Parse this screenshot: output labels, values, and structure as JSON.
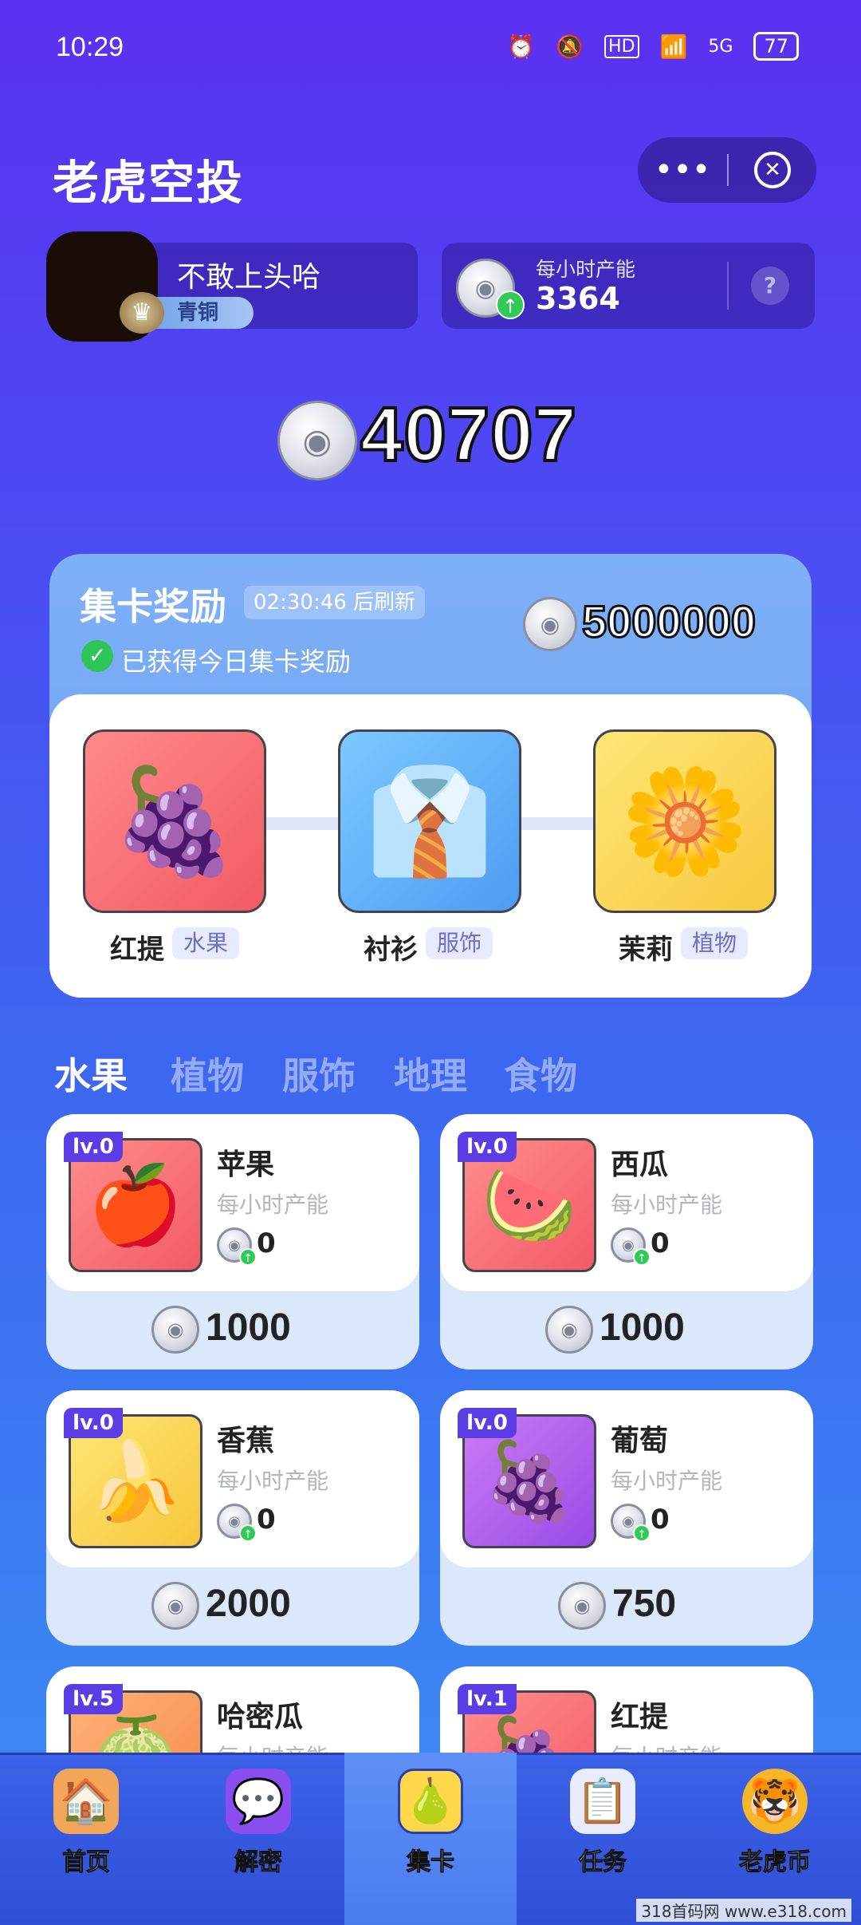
{
  "status_bar": {
    "time": "10:29",
    "network": "5G",
    "battery": "77"
  },
  "header": {
    "title": "老虎空投"
  },
  "profile": {
    "username": "不敢上头哈",
    "rank": "青铜"
  },
  "production": {
    "label": "每小时产能",
    "value": "3364",
    "help": "?"
  },
  "balance": "40707",
  "collect": {
    "title": "集卡奖励",
    "timer": "02:30:46 后刷新",
    "reward": "5000000",
    "claimed_text": "已获得今日集卡奖励",
    "targets": [
      {
        "name": "红提",
        "tag": "水果",
        "icon": "grape"
      },
      {
        "name": "衬衫",
        "tag": "服饰",
        "icon": "shirt"
      },
      {
        "name": "茉莉",
        "tag": "植物",
        "icon": "flower"
      }
    ]
  },
  "tabs": [
    "水果",
    "植物",
    "服饰",
    "地理",
    "食物"
  ],
  "active_tab": "水果",
  "items": [
    {
      "level": "lv.0",
      "name": "苹果",
      "sub": "每小时产能",
      "prod": "0",
      "price": "1000",
      "icon": "apple"
    },
    {
      "level": "lv.0",
      "name": "西瓜",
      "sub": "每小时产能",
      "prod": "0",
      "price": "1000",
      "icon": "watermelon"
    },
    {
      "level": "lv.0",
      "name": "香蕉",
      "sub": "每小时产能",
      "prod": "0",
      "price": "2000",
      "icon": "banana"
    },
    {
      "level": "lv.0",
      "name": "葡萄",
      "sub": "每小时产能",
      "prod": "0",
      "price": "750",
      "icon": "grape"
    },
    {
      "level": "lv.5",
      "name": "哈密瓜",
      "sub": "每小时产能",
      "icon": "melon"
    },
    {
      "level": "lv.1",
      "name": "红提",
      "sub": "每小时产能",
      "icon": "grape"
    }
  ],
  "nav": [
    {
      "label": "首页",
      "icon": "home-icon"
    },
    {
      "label": "解密",
      "icon": "chat-icon"
    },
    {
      "label": "集卡",
      "icon": "card-icon"
    },
    {
      "label": "任务",
      "icon": "task-icon"
    },
    {
      "label": "老虎币",
      "icon": "tiger-coin-icon"
    }
  ],
  "watermark": "318首码网  www.e318.com",
  "colors": {
    "accent": "#5b3de6",
    "success": "#2ecc55",
    "bg_top": "#5b30f0",
    "bg_bottom": "#3f8ff4"
  }
}
